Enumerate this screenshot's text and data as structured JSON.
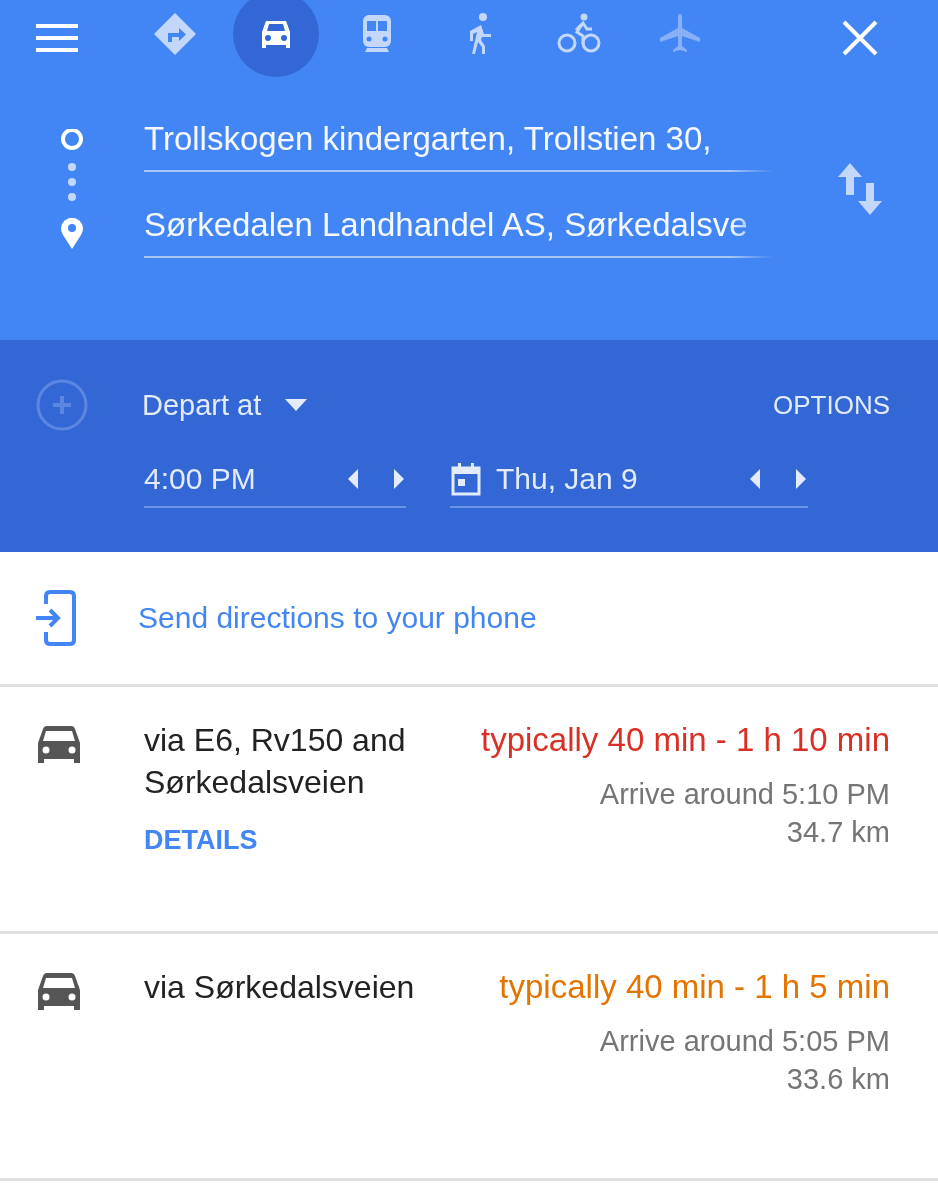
{
  "modes": [
    {
      "kind": "best",
      "selected": false,
      "disabled": false
    },
    {
      "kind": "car",
      "selected": true,
      "disabled": false
    },
    {
      "kind": "transit",
      "selected": false,
      "disabled": false
    },
    {
      "kind": "walk",
      "selected": false,
      "disabled": false
    },
    {
      "kind": "bike",
      "selected": false,
      "disabled": false
    },
    {
      "kind": "flight",
      "selected": false,
      "disabled": true
    }
  ],
  "origin": {
    "value": "Trollskogen kindergarten, Trollstien 30,"
  },
  "destination": {
    "value": "Sørkedalen Landhandel AS, Sørkedalsve"
  },
  "depart": {
    "label": "Depart at",
    "options": "OPTIONS",
    "time": "4:00 PM",
    "date": "Thu, Jan 9"
  },
  "send": {
    "label": "Send directions to your phone"
  },
  "routes": [
    {
      "via": "via E6, Rv150 and Sørkedalsveien",
      "duration": "typically 40 min - 1 h 10 min",
      "color": "#d93025",
      "arrive": "Arrive around 5:10 PM",
      "distance": "34.7 km",
      "details": "DETAILS"
    },
    {
      "via": "via Sørkedalsveien",
      "duration": "typically 40 min - 1 h 5 min",
      "color": "#e37400",
      "arrive": "Arrive around 5:05 PM",
      "distance": "33.6 km"
    }
  ]
}
